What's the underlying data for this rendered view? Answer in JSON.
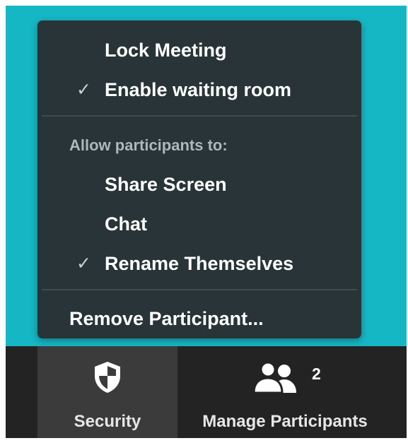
{
  "security_menu": {
    "items": [
      {
        "label": "Lock Meeting",
        "checked": false
      },
      {
        "label": "Enable waiting room",
        "checked": true
      }
    ],
    "section_header": "Allow participants to:",
    "participant_options": [
      {
        "label": "Share Screen",
        "checked": false
      },
      {
        "label": "Chat",
        "checked": false
      },
      {
        "label": "Rename Themselves",
        "checked": true
      }
    ],
    "remove_participant": "Remove Participant...",
    "check_glyph": "✓"
  },
  "toolbar": {
    "security": {
      "label": "Security",
      "icon": "shield-icon",
      "active": true
    },
    "participants": {
      "label": "Manage Participants",
      "icon": "participants-icon",
      "count": "2"
    }
  },
  "colors": {
    "meeting_background": "#16b7c4",
    "menu_background": "#283437",
    "toolbar_background": "#232323",
    "active_button": "#3b3b3b"
  }
}
